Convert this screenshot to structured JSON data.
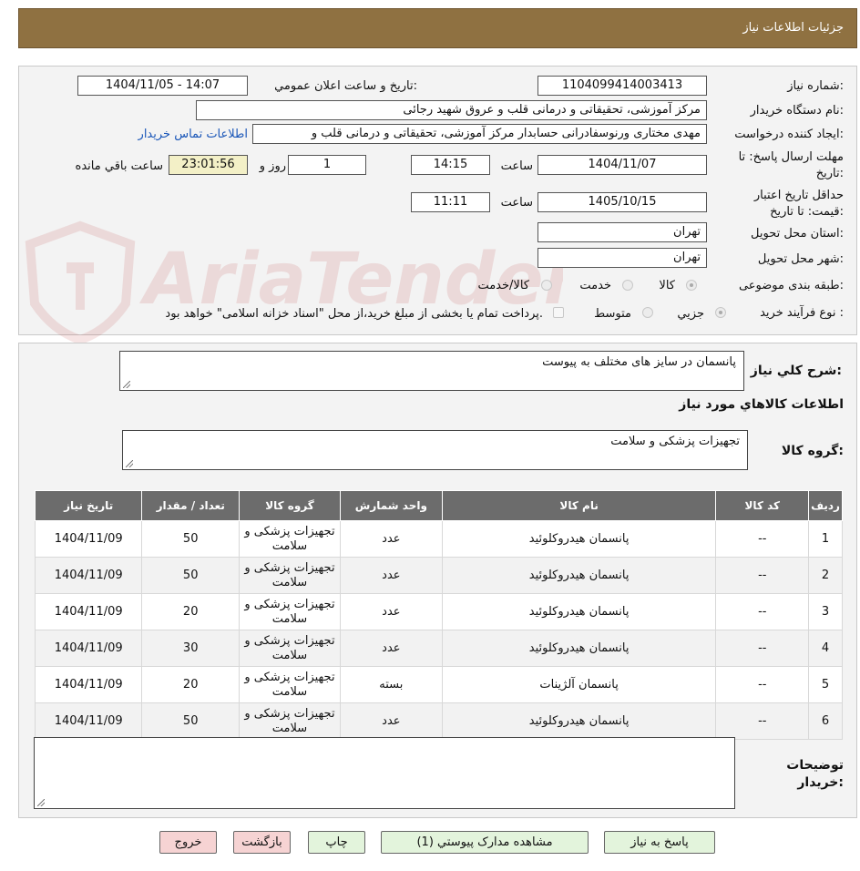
{
  "header": {
    "title": "جزئيات اطلاعات نياز"
  },
  "watermark": {
    "text": "AriaTender.neT"
  },
  "form": {
    "need_number": {
      "label": "شماره نياز:",
      "value": "1104099414003413"
    },
    "announce": {
      "label": "تاريخ و ساعت اعلان عمومي:",
      "value": "1404/11/05 - 14:07"
    },
    "buyer": {
      "label": "نام دستگاه خريدار:",
      "value": "مرکز آموزشی، تحقیقاتی و درمانی قلب و عروق شهید رجائی"
    },
    "requester": {
      "label": "ايجاد کننده درخواست:",
      "value": "مهدی مختاری ورنوسفادرانی حسابدار مرکز آموزشی، تحقیقاتی و درمانی قلب و",
      "contact_link": "اطلاعات تماس خريدار"
    },
    "deadline": {
      "label_line1": "مهلت ارسال پاسخ: تا",
      "label_line2": "تاريخ:",
      "date": "1404/11/07",
      "time_label": "ساعت",
      "time": "14:15",
      "days": "1",
      "days_label": "روز و",
      "remaining": "23:01:56",
      "remaining_label": "ساعت باقي مانده"
    },
    "validity": {
      "label_line1": "حداقل تاريخ اعتبار",
      "label_line2": "قيمت: تا تاريخ:",
      "date": "1405/10/15",
      "time_label": "ساعت",
      "time": "11:11"
    },
    "province": {
      "label": "استان محل تحويل:",
      "value": "تهران"
    },
    "city": {
      "label": "شهر محل تحويل:",
      "value": "تهران"
    },
    "category": {
      "label": "طبقه بندی موضوعی:",
      "options": [
        "کالا",
        "خدمت",
        "کالا/خدمت"
      ],
      "selected": "کالا"
    },
    "process": {
      "label": "نوع فرآيند خريد :",
      "options": [
        "جزيي",
        "متوسط"
      ],
      "selected": "جزيي",
      "payment_note": "پرداخت تمام يا بخشی از مبلغ خريد،از محل \"اسناد خزانه اسلامی\" خواهد بود."
    }
  },
  "details": {
    "summary_label": "شرح کلي نياز:",
    "summary_value": "پانسمان در سایز های مختلف به پیوست",
    "goods_info_title": "اطلاعات کالاهاي مورد نياز",
    "group_label": "گروه کالا:",
    "group_value": "تجهیزات پزشکی و سلامت",
    "table": {
      "headers": [
        "رديف",
        "کد کالا",
        "نام کالا",
        "واحد شمارش",
        "گروه کالا",
        "تعداد / مقدار",
        "تاريخ نياز"
      ],
      "rows": [
        [
          "1",
          "--",
          "پانسمان هیدروکلوئید",
          "عدد",
          "تجهیزات پزشکی و سلامت",
          "50",
          "1404/11/09"
        ],
        [
          "2",
          "--",
          "پانسمان هیدروکلوئید",
          "عدد",
          "تجهیزات پزشکی و سلامت",
          "50",
          "1404/11/09"
        ],
        [
          "3",
          "--",
          "پانسمان هیدروکلوئید",
          "عدد",
          "تجهیزات پزشکی و سلامت",
          "20",
          "1404/11/09"
        ],
        [
          "4",
          "--",
          "پانسمان هیدروکلوئید",
          "عدد",
          "تجهیزات پزشکی و سلامت",
          "30",
          "1404/11/09"
        ],
        [
          "5",
          "--",
          "پانسمان آلژینات",
          "بسته",
          "تجهیزات پزشکی و سلامت",
          "20",
          "1404/11/09"
        ],
        [
          "6",
          "--",
          "پانسمان هیدروکلوئید",
          "عدد",
          "تجهیزات پزشکی و سلامت",
          "50",
          "1404/11/09"
        ]
      ]
    },
    "buyer_notes_label_line1": "توضيحات",
    "buyer_notes_label_line2": "خريدار:",
    "buyer_notes_value": ""
  },
  "buttons": {
    "reply": "پاسخ به نياز",
    "attachments": "مشاهده مدارک پيوستي (1)",
    "print": "چاپ",
    "back": "بازگشت",
    "exit": "خروج"
  },
  "colors": {
    "header": "#8f7141",
    "table_header": "#6c6c6c",
    "link": "#1a56b8",
    "remaining_bg": "#f3f0c7"
  }
}
